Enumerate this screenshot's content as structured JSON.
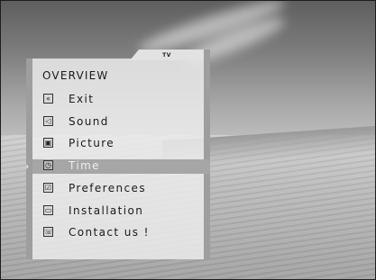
{
  "menu": {
    "tab": "TV",
    "title": "OVERVIEW",
    "selected_marker": "›",
    "items": [
      {
        "label": "Exit",
        "icon": "exit-icon",
        "glyph": "«"
      },
      {
        "label": "Sound",
        "icon": "speaker-icon",
        "glyph": "◁"
      },
      {
        "label": "Picture",
        "icon": "picture-icon",
        "glyph": "▣"
      },
      {
        "label": "Time",
        "icon": "clock-icon",
        "glyph": "◷",
        "selected": true
      },
      {
        "label": "Preferences",
        "icon": "preferences-icon",
        "glyph": "☑"
      },
      {
        "label": "Installation",
        "icon": "installation-icon",
        "glyph": "▭"
      },
      {
        "label": "Contact us !",
        "icon": "contact-icon",
        "glyph": "☏"
      }
    ]
  }
}
